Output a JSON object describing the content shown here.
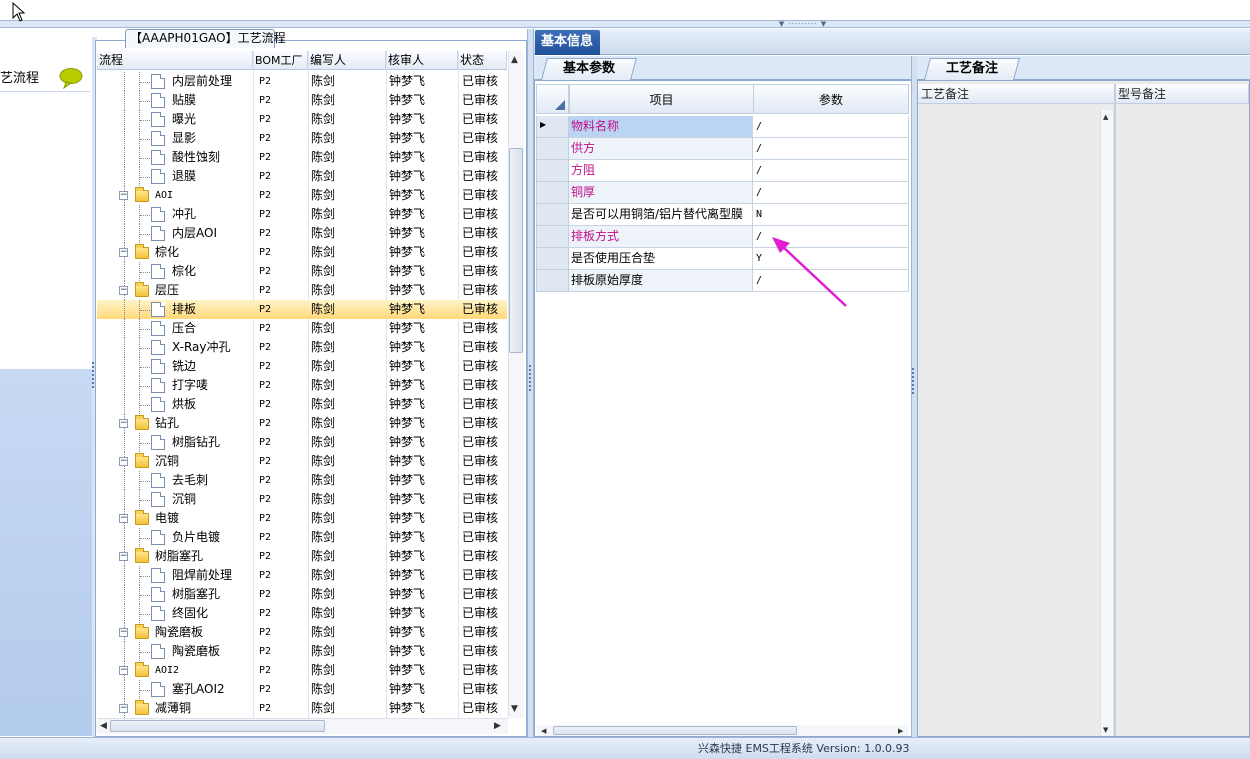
{
  "nav": {
    "item_label": "艺流程",
    "icon": "speech-bubble-icon",
    "icon_color": "#b9cc00"
  },
  "tree_panel": {
    "title": "【AAAPH01GAO】工艺流程",
    "columns": [
      "流程",
      "BOM工厂",
      "编写人",
      "核审人",
      "状态"
    ],
    "rows": [
      {
        "name": "内层前处理",
        "type": "doc",
        "level": 2,
        "bom": "P2",
        "author": "陈剑",
        "reviewer": "钟梦飞",
        "status": "已审核"
      },
      {
        "name": "贴膜",
        "type": "doc",
        "level": 2,
        "bom": "P2",
        "author": "陈剑",
        "reviewer": "钟梦飞",
        "status": "已审核"
      },
      {
        "name": "曝光",
        "type": "doc",
        "level": 2,
        "bom": "P2",
        "author": "陈剑",
        "reviewer": "钟梦飞",
        "status": "已审核"
      },
      {
        "name": "显影",
        "type": "doc",
        "level": 2,
        "bom": "P2",
        "author": "陈剑",
        "reviewer": "钟梦飞",
        "status": "已审核"
      },
      {
        "name": "酸性蚀刻",
        "type": "doc",
        "level": 2,
        "bom": "P2",
        "author": "陈剑",
        "reviewer": "钟梦飞",
        "status": "已审核"
      },
      {
        "name": "退膜",
        "type": "doc",
        "level": 2,
        "bom": "P2",
        "author": "陈剑",
        "reviewer": "钟梦飞",
        "status": "已审核"
      },
      {
        "name": "AOI",
        "type": "folder",
        "level": 1,
        "bom": "P2",
        "author": "陈剑",
        "reviewer": "钟梦飞",
        "status": "已审核"
      },
      {
        "name": "冲孔",
        "type": "doc",
        "level": 2,
        "bom": "P2",
        "author": "陈剑",
        "reviewer": "钟梦飞",
        "status": "已审核"
      },
      {
        "name": "内层AOI",
        "type": "doc",
        "level": 2,
        "bom": "P2",
        "author": "陈剑",
        "reviewer": "钟梦飞",
        "status": "已审核"
      },
      {
        "name": "棕化",
        "type": "folder",
        "level": 1,
        "bom": "P2",
        "author": "陈剑",
        "reviewer": "钟梦飞",
        "status": "已审核"
      },
      {
        "name": "棕化",
        "type": "doc",
        "level": 2,
        "bom": "P2",
        "author": "陈剑",
        "reviewer": "钟梦飞",
        "status": "已审核"
      },
      {
        "name": "层压",
        "type": "folder",
        "level": 1,
        "bom": "P2",
        "author": "陈剑",
        "reviewer": "钟梦飞",
        "status": "已审核"
      },
      {
        "name": "排板",
        "type": "doc",
        "level": 2,
        "bom": "P2",
        "author": "陈剑",
        "reviewer": "钟梦飞",
        "status": "已审核",
        "selected": true
      },
      {
        "name": "压合",
        "type": "doc",
        "level": 2,
        "bom": "P2",
        "author": "陈剑",
        "reviewer": "钟梦飞",
        "status": "已审核"
      },
      {
        "name": "X-Ray冲孔",
        "type": "doc",
        "level": 2,
        "bom": "P2",
        "author": "陈剑",
        "reviewer": "钟梦飞",
        "status": "已审核"
      },
      {
        "name": "铣边",
        "type": "doc",
        "level": 2,
        "bom": "P2",
        "author": "陈剑",
        "reviewer": "钟梦飞",
        "status": "已审核"
      },
      {
        "name": "打字唛",
        "type": "doc",
        "level": 2,
        "bom": "P2",
        "author": "陈剑",
        "reviewer": "钟梦飞",
        "status": "已审核"
      },
      {
        "name": "烘板",
        "type": "doc",
        "level": 2,
        "bom": "P2",
        "author": "陈剑",
        "reviewer": "钟梦飞",
        "status": "已审核"
      },
      {
        "name": "钻孔",
        "type": "folder",
        "level": 1,
        "bom": "P2",
        "author": "陈剑",
        "reviewer": "钟梦飞",
        "status": "已审核"
      },
      {
        "name": "树脂钻孔",
        "type": "doc",
        "level": 2,
        "bom": "P2",
        "author": "陈剑",
        "reviewer": "钟梦飞",
        "status": "已审核"
      },
      {
        "name": "沉铜",
        "type": "folder",
        "level": 1,
        "bom": "P2",
        "author": "陈剑",
        "reviewer": "钟梦飞",
        "status": "已审核"
      },
      {
        "name": "去毛刺",
        "type": "doc",
        "level": 2,
        "bom": "P2",
        "author": "陈剑",
        "reviewer": "钟梦飞",
        "status": "已审核"
      },
      {
        "name": "沉铜",
        "type": "doc",
        "level": 2,
        "bom": "P2",
        "author": "陈剑",
        "reviewer": "钟梦飞",
        "status": "已审核"
      },
      {
        "name": "电镀",
        "type": "folder",
        "level": 1,
        "bom": "P2",
        "author": "陈剑",
        "reviewer": "钟梦飞",
        "status": "已审核"
      },
      {
        "name": "负片电镀",
        "type": "doc",
        "level": 2,
        "bom": "P2",
        "author": "陈剑",
        "reviewer": "钟梦飞",
        "status": "已审核"
      },
      {
        "name": "树脂塞孔",
        "type": "folder",
        "level": 1,
        "bom": "P2",
        "author": "陈剑",
        "reviewer": "钟梦飞",
        "status": "已审核"
      },
      {
        "name": "阻焊前处理",
        "type": "doc",
        "level": 2,
        "bom": "P2",
        "author": "陈剑",
        "reviewer": "钟梦飞",
        "status": "已审核"
      },
      {
        "name": "树脂塞孔",
        "type": "doc",
        "level": 2,
        "bom": "P2",
        "author": "陈剑",
        "reviewer": "钟梦飞",
        "status": "已审核"
      },
      {
        "name": "终固化",
        "type": "doc",
        "level": 2,
        "bom": "P2",
        "author": "陈剑",
        "reviewer": "钟梦飞",
        "status": "已审核"
      },
      {
        "name": "陶瓷磨板",
        "type": "folder",
        "level": 1,
        "bom": "P2",
        "author": "陈剑",
        "reviewer": "钟梦飞",
        "status": "已审核"
      },
      {
        "name": "陶瓷磨板",
        "type": "doc",
        "level": 2,
        "bom": "P2",
        "author": "陈剑",
        "reviewer": "钟梦飞",
        "status": "已审核"
      },
      {
        "name": "AOI2",
        "type": "folder",
        "level": 1,
        "bom": "P2",
        "author": "陈剑",
        "reviewer": "钟梦飞",
        "status": "已审核"
      },
      {
        "name": "塞孔AOI2",
        "type": "doc",
        "level": 2,
        "bom": "P2",
        "author": "陈剑",
        "reviewer": "钟梦飞",
        "status": "已审核"
      },
      {
        "name": "减薄铜",
        "type": "folder",
        "level": 1,
        "bom": "P2",
        "author": "陈剑",
        "reviewer": "钟梦飞",
        "status": "已审核"
      }
    ]
  },
  "info_panel": {
    "title": "基本信息",
    "subtab": "基本参数",
    "columns": [
      "项目",
      "参数"
    ],
    "params": [
      {
        "item": "物料名称",
        "value": "/",
        "magenta": true,
        "current": true
      },
      {
        "item": "供方",
        "value": "/",
        "magenta": true
      },
      {
        "item": "方阻",
        "value": "/",
        "magenta": true
      },
      {
        "item": "铜厚",
        "value": "/",
        "magenta": true
      },
      {
        "item": "是否可以用铜箔/铝片替代离型膜",
        "value": "N",
        "magenta": false
      },
      {
        "item": "排板方式",
        "value": "/",
        "magenta": true
      },
      {
        "item": "是否使用压合垫",
        "value": "Y",
        "magenta": false
      },
      {
        "item": "排板原始厚度",
        "value": "/",
        "magenta": false
      }
    ],
    "annotation_color": "#e020d0"
  },
  "remarks_panel": {
    "tab": "工艺备注",
    "columns": [
      "工艺备注",
      "型号备注"
    ]
  },
  "status_bar": {
    "text": "兴森快捷 EMS工程系统 Version: 1.0.0.93"
  },
  "colors": {
    "accent": "#1f4f9a",
    "selection": "#ffd97a",
    "magenta_text": "#c0108a"
  }
}
